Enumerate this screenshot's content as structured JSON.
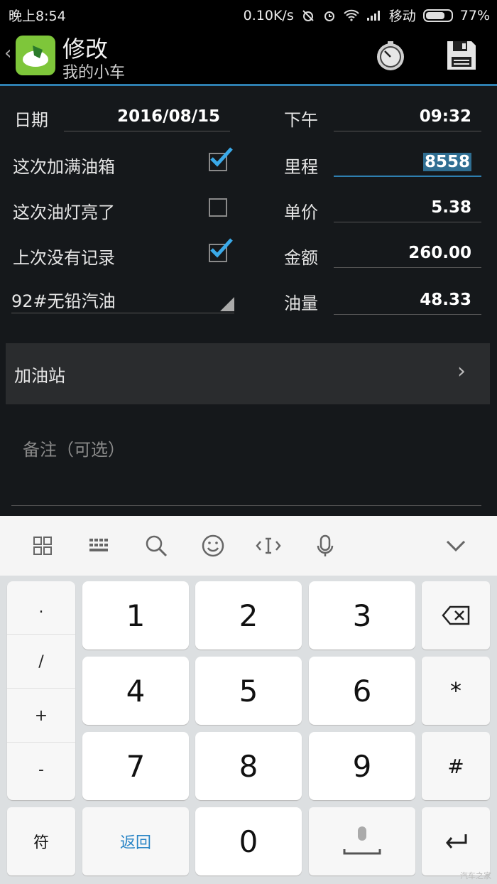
{
  "status": {
    "time": "晚上8:54",
    "speed": "0.10K/s",
    "carrier": "移动",
    "battery": "77%",
    "battery_level": 0.77
  },
  "app": {
    "back": "‹",
    "title": "修改",
    "subtitle": "我的小车",
    "icons": [
      "timer-icon",
      "save-icon"
    ]
  },
  "form": {
    "date_label": "日期",
    "date_value": "2016/08/15",
    "ampm_label": "下午",
    "time_value": "09:32",
    "full_tank_label": "这次加满油箱",
    "full_tank_checked": true,
    "mileage_label": "里程",
    "mileage_value": "8558",
    "light_label": "这次油灯亮了",
    "light_checked": false,
    "price_label": "单价",
    "price_value": "5.38",
    "nolast_label": "上次没有记录",
    "nolast_checked": true,
    "amount_label": "金额",
    "amount_value": "260.00",
    "fuel_type": "92#无铅汽油",
    "volume_label": "油量",
    "volume_value": "48.33",
    "station_label": "加油站",
    "note_placeholder": "备注（可选）"
  },
  "keyboard": {
    "toolbar_icons": [
      "grid-icon",
      "keyboard-icon",
      "search-icon",
      "emoji-icon",
      "cursor-icon",
      "mic-icon",
      "collapse-icon"
    ],
    "side_symbols": [
      ".",
      "/",
      "+",
      "-"
    ],
    "digits": [
      "1",
      "2",
      "3",
      "4",
      "5",
      "6",
      "7",
      "8",
      "9",
      "0"
    ],
    "star": "*",
    "hash": "#",
    "fu": "符",
    "return_label": "返回"
  },
  "watermark": "汽车之家"
}
